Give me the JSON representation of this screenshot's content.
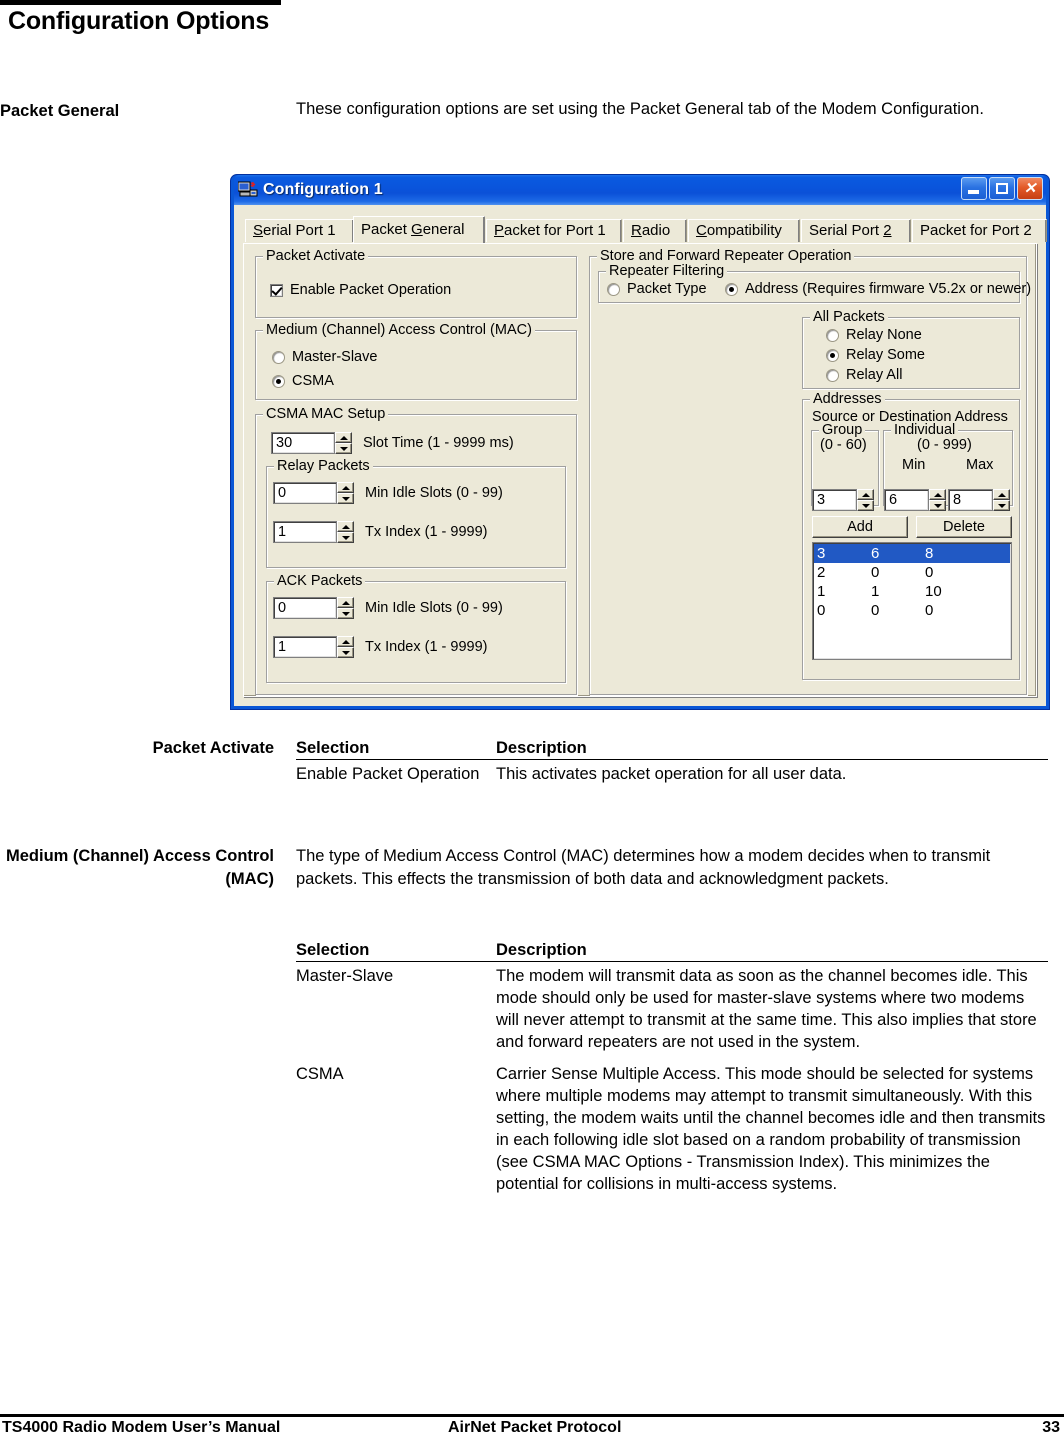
{
  "document": {
    "title": "Configuration Options",
    "side_heading_packet_general": "Packet General",
    "intro": "These configuration options are set using the Packet General tab of the Modem Configuration.",
    "side_heading_packet_activate": "Packet Activate",
    "side_heading_mac": "Medium (Channel) Access Control (MAC)",
    "mac_paragraph": "The type of Medium Access Control (MAC) determines how a modem decides when to transmit packets.  This effects the transmission of both data and acknowledgment packets."
  },
  "table_packet_activate": {
    "headers": [
      "Selection",
      "Description"
    ],
    "rows": [
      {
        "selection": "Enable Packet Operation",
        "description": "This activates packet operation for all user data."
      }
    ]
  },
  "table_mac": {
    "headers": [
      "Selection",
      "Description"
    ],
    "rows": [
      {
        "selection": "Master-Slave",
        "description": "The modem will transmit data as soon as the channel becomes idle.  This mode should only be used for master-slave systems where two modems will never attempt to transmit at the same time.  This also implies that store and forward repeaters are not used in the system."
      },
      {
        "selection": "CSMA",
        "description": "Carrier Sense Multiple Access.  This mode should be selected for systems where multiple modems may attempt to transmit simultaneously.  With this setting, the modem waits until the channel becomes idle and then transmits in each following idle slot based on a random probability of transmission (see CSMA MAC Options - Transmission Index).  This minimizes the potential for collisions in multi-access systems."
      }
    ]
  },
  "footer": {
    "left": "TS4000 Radio Modem User’s Manual",
    "center": "AirNet Packet Protocol",
    "right": "33"
  },
  "dialog": {
    "title": "Configuration 1",
    "window_buttons": {
      "minimize": "minimize",
      "maximize": "maximize",
      "close": "✕"
    },
    "tabs": [
      {
        "label": "Serial Port 1",
        "accel": "S",
        "active": false
      },
      {
        "label": "Packet General",
        "accel": "G",
        "active": true
      },
      {
        "label": "Packet for Port 1",
        "accel": "P",
        "active": false
      },
      {
        "label": "Radio",
        "accel": "R",
        "active": false
      },
      {
        "label": "Compatibility",
        "accel": "C",
        "active": false
      },
      {
        "label": "Serial Port 2",
        "accel": "2",
        "active": false
      },
      {
        "label": "Packet for Port 2",
        "accel": "",
        "active": false
      }
    ],
    "left_panel": {
      "packet_activate": {
        "caption": "Packet Activate",
        "checkbox_label": "Enable Packet Operation",
        "checkbox_checked": true
      },
      "mac": {
        "caption": "Medium (Channel) Access Control (MAC)",
        "options": [
          {
            "label": "Master-Slave",
            "selected": false
          },
          {
            "label": "CSMA",
            "selected": true
          }
        ]
      },
      "csma_setup": {
        "caption": "CSMA MAC Setup",
        "slot_time": {
          "value": "30",
          "label": "Slot Time (1 - 9999 ms)"
        },
        "relay_packets": {
          "caption": "Relay Packets",
          "min_idle_slots": {
            "value": "0",
            "label": "Min Idle Slots  (0 - 99)"
          },
          "tx_index": {
            "value": "1",
            "label": "Tx Index  (1 - 9999)"
          }
        },
        "ack_packets": {
          "caption": "ACK Packets",
          "min_idle_slots": {
            "value": "0",
            "label": "Min Idle Slots  (0 - 99)"
          },
          "tx_index": {
            "value": "1",
            "label": "Tx Index  (1 - 9999)"
          }
        }
      }
    },
    "right_panel": {
      "caption": "Store and Forward Repeater Operation",
      "repeater_filtering": {
        "caption": "Repeater Filtering",
        "options": [
          {
            "label": "Packet Type",
            "selected": false
          },
          {
            "label": "Address (Requires firmware V5.2x or newer)",
            "selected": true
          }
        ]
      },
      "all_packets": {
        "caption": "All Packets",
        "options": [
          {
            "label": "Relay None",
            "selected": false
          },
          {
            "label": "Relay Some",
            "selected": true
          },
          {
            "label": "Relay All",
            "selected": false
          }
        ]
      },
      "addresses": {
        "caption": "Addresses",
        "subtitle": "Source or Destination Address",
        "group": {
          "caption": "Group",
          "range": "(0 - 60)",
          "value": "3"
        },
        "individual": {
          "caption": "Individual",
          "range": "(0 - 999)",
          "min_label": "Min",
          "max_label": "Max",
          "min_value": "6",
          "max_value": "8"
        },
        "add_button": "Add",
        "delete_button": "Delete",
        "list": [
          {
            "group": "3",
            "min": "6",
            "max": "8",
            "selected": true
          },
          {
            "group": "2",
            "min": "0",
            "max": "0",
            "selected": false
          },
          {
            "group": "1",
            "min": "1",
            "max": "10",
            "selected": false
          },
          {
            "group": "0",
            "min": "0",
            "max": "0",
            "selected": false
          }
        ]
      }
    }
  }
}
